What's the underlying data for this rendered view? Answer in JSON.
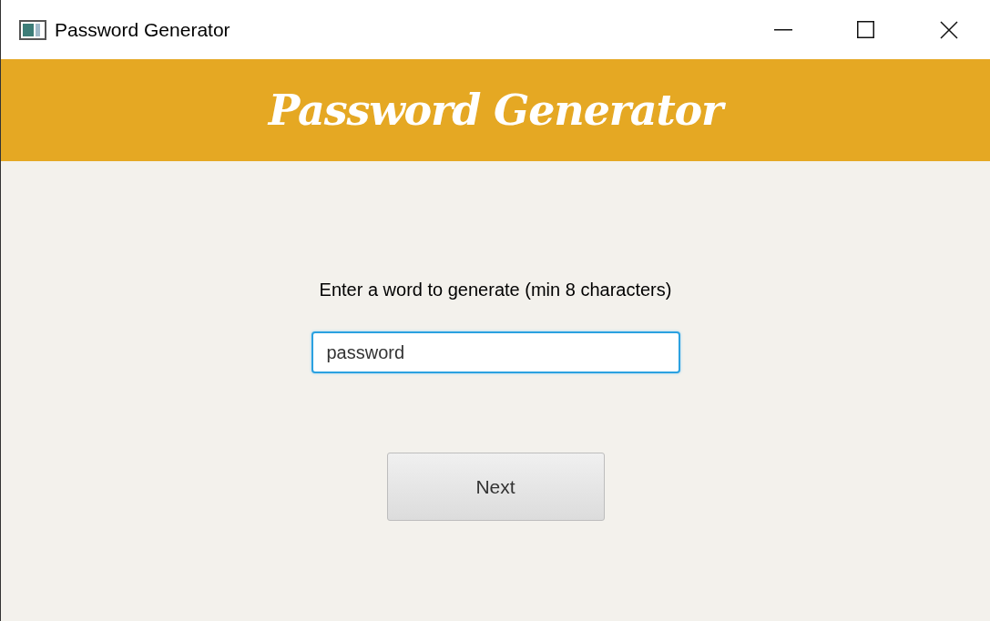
{
  "window": {
    "title": "Password Generator"
  },
  "header": {
    "title": "Password Generator"
  },
  "prompt": "Enter a word to generate (min 8 characters)",
  "field": {
    "value": "password",
    "focused": true
  },
  "buttons": [
    "Next"
  ]
}
